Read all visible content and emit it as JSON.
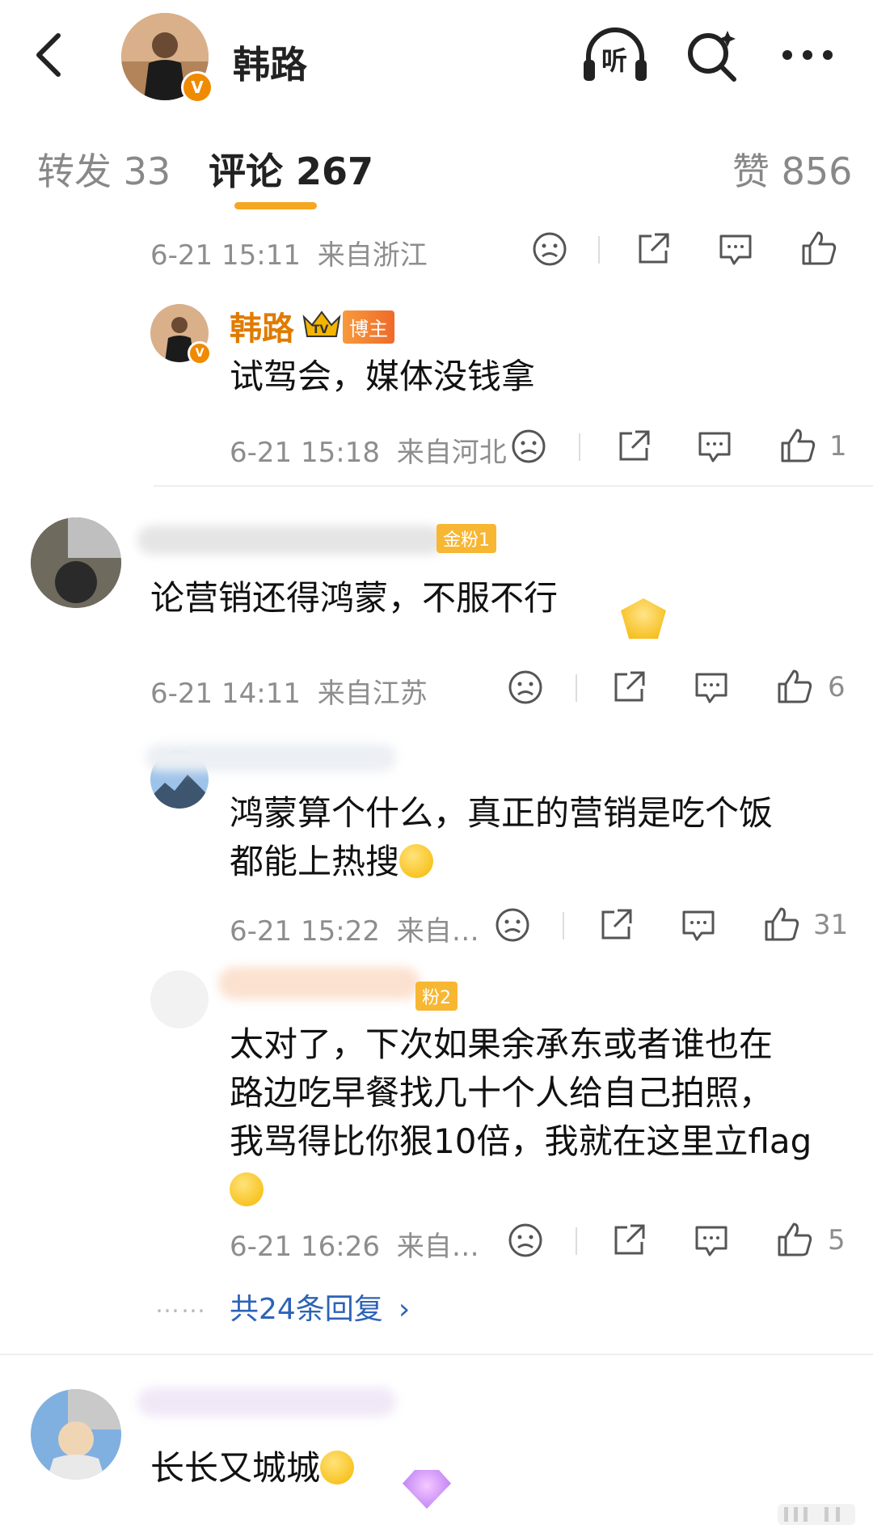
{
  "header": {
    "back_label": "back",
    "title": "韩路",
    "listen_label": "听",
    "icons": [
      "back-arrow-icon",
      "headphones-icon",
      "search-sparkle-icon",
      "more-icon"
    ],
    "verified": "V"
  },
  "tabs": [
    {
      "label": "转发 33"
    },
    {
      "label": "评论 267"
    },
    {
      "label": "赞 856"
    }
  ],
  "main_post_meta": {
    "time": "6-21 15:11",
    "location": "来自浙江"
  },
  "comments": [
    {
      "author": "韩路",
      "crown_label": "TV",
      "role_tag": "博主",
      "text": "试驾会，媒体没钱拿",
      "time": "6-21 15:18",
      "location": "来自河北",
      "likes": "1"
    },
    {
      "fan_tag": "金粉1",
      "text": "论营销还得鸿蒙，不服不行",
      "time": "6-21 14:11",
      "location": "来自江苏",
      "likes": "6",
      "replies": [
        {
          "text_line1": "鸿蒙算个什么，真正的营销是吃个饭",
          "text_line2": "都能上热搜",
          "time": "6-21 15:22",
          "location": "来自…",
          "likes": "31"
        },
        {
          "fan_tag": "粉2",
          "text_line1": "太对了，下次如果余承东或者谁也在",
          "text_line2": "路边吃早餐找几十个人给自己拍照，",
          "text_line3": "我骂得比你狠10倍，我就在这里立flag",
          "time": "6-21 16:26",
          "location": "来自…",
          "likes": "5"
        }
      ],
      "more_dots": "……",
      "more_replies": "共24条回复",
      "more_chevron": "›"
    },
    {
      "text": "长长又城城"
    }
  ],
  "colors": {
    "accent": "#f5a623",
    "link": "#2d63b8",
    "meta": "#8d8d8d",
    "host_name": "#e07b00"
  }
}
